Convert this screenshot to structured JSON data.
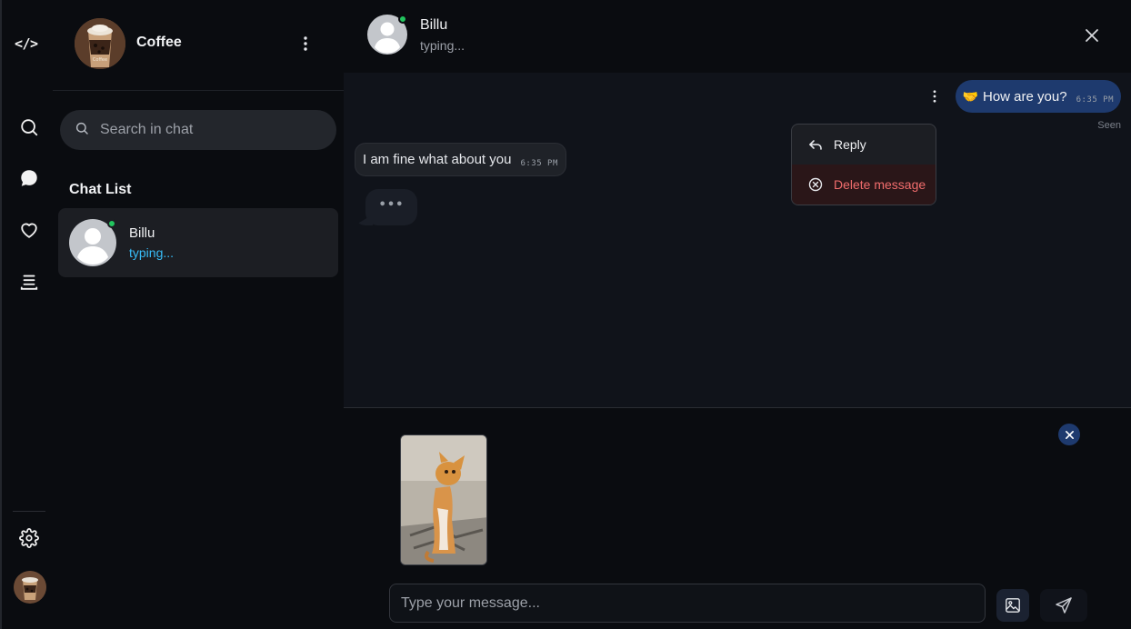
{
  "rail": {
    "logo": "</>",
    "icons": [
      "search-icon",
      "chat-bubble-icon",
      "heart-icon",
      "stack-icon",
      "gear-icon"
    ]
  },
  "sidebar": {
    "profile_name": "Coffee",
    "search_placeholder": "Search in chat",
    "list_title": "Chat List",
    "chats": [
      {
        "name": "Billu",
        "status": "typing..."
      }
    ]
  },
  "chat": {
    "contact_name": "Billu",
    "contact_status": "typing...",
    "messages": [
      {
        "direction": "out",
        "emoji": "🤝",
        "text": "How are you?",
        "time": "6:35 PM",
        "receipt": "Seen"
      },
      {
        "direction": "in",
        "text": "I am fine what about you",
        "time": "6:35 PM"
      }
    ],
    "typing_indicator": "•••",
    "context_menu": {
      "reply_label": "Reply",
      "delete_label": "Delete message"
    },
    "composer": {
      "placeholder": "Type your message..."
    }
  },
  "colors": {
    "accent": "#1e3a6e",
    "online": "#22c55e",
    "typing": "#38bdf8",
    "danger": "#f26d6d"
  }
}
